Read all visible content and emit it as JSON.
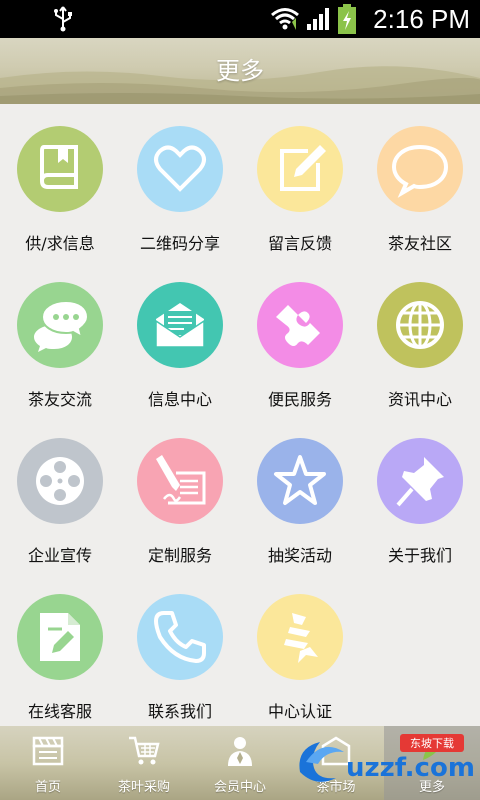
{
  "status_bar": {
    "time": "2:16 PM"
  },
  "header": {
    "title": "更多"
  },
  "colors": {
    "green": "#b3cc72",
    "blue": "#a9dcf6",
    "yellow": "#fbe79a",
    "orange": "#fdd8a4",
    "lightgreen": "#98d590",
    "teal": "#43c6b1",
    "pink": "#f38ce6",
    "olive": "#bfc25d",
    "gray": "#bfc5cc",
    "rose": "#f8a4b3",
    "periwinkle": "#9ab3ea",
    "purple": "#b9a8f6"
  },
  "grid": {
    "items": [
      {
        "label": "供/求信息",
        "icon": "book-icon",
        "color": "#b3cc72"
      },
      {
        "label": "二维码分享",
        "icon": "heart-icon",
        "color": "#a9dcf6"
      },
      {
        "label": "留言反馈",
        "icon": "edit-icon",
        "color": "#fbe79a"
      },
      {
        "label": "茶友社区",
        "icon": "chat-bubble-icon",
        "color": "#fdd8a4"
      },
      {
        "label": "茶友交流",
        "icon": "chat-bubbles-icon",
        "color": "#98d590"
      },
      {
        "label": "信息中心",
        "icon": "mail-icon",
        "color": "#43c6b1"
      },
      {
        "label": "便民服务",
        "icon": "puzzle-icon",
        "color": "#f38ce6"
      },
      {
        "label": "资讯中心",
        "icon": "globe-icon",
        "color": "#bfc25d"
      },
      {
        "label": "企业宣传",
        "icon": "film-reel-icon",
        "color": "#bfc5cc"
      },
      {
        "label": "定制服务",
        "icon": "sign-pen-icon",
        "color": "#f8a4b3"
      },
      {
        "label": "抽奖活动",
        "icon": "star-icon",
        "color": "#9ab3ea"
      },
      {
        "label": "关于我们",
        "icon": "pushpin-icon",
        "color": "#b9a8f6"
      },
      {
        "label": "在线客服",
        "icon": "document-edit-icon",
        "color": "#98d590"
      },
      {
        "label": "联系我们",
        "icon": "phone-icon",
        "color": "#a9dcf6"
      },
      {
        "label": "中心认证",
        "icon": "certificate-icon",
        "color": "#fbe79a"
      }
    ]
  },
  "tab_bar": {
    "tabs": [
      {
        "label": "首页",
        "icon": "clapperboard-icon"
      },
      {
        "label": "茶叶采购",
        "icon": "cart-icon"
      },
      {
        "label": "会员中心",
        "icon": "member-icon"
      },
      {
        "label": "茶市场",
        "icon": "market-icon"
      },
      {
        "label": "更多",
        "icon": "more-icon"
      }
    ]
  },
  "watermark": {
    "text": "uzzf.com",
    "badge": "东坡下载"
  }
}
